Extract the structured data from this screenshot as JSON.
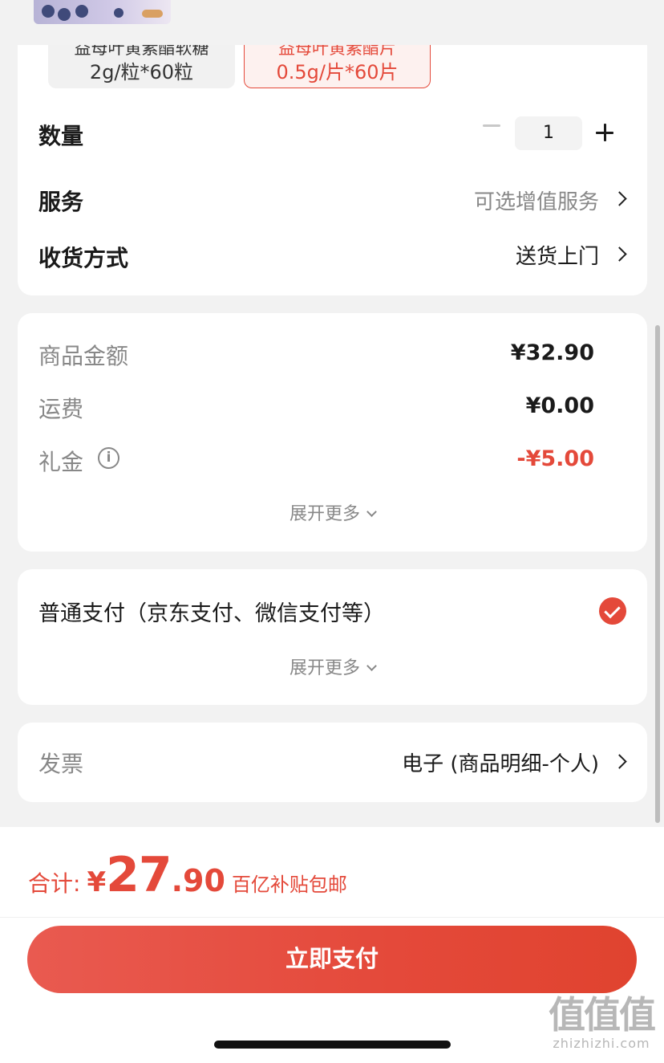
{
  "product_specs": [
    {
      "name": "益母叶黄素酯软糖",
      "size": "2g/粒*60粒",
      "selected": false
    },
    {
      "name": "益母叶黄素酯片",
      "size": "0.5g/片*60片",
      "selected": true
    }
  ],
  "quantity": {
    "label": "数量",
    "value": "1"
  },
  "service": {
    "label": "服务",
    "value": "可选增值服务"
  },
  "delivery": {
    "label": "收货方式",
    "value": "送货上门"
  },
  "fees": {
    "goods_amount": {
      "label": "商品金额",
      "value": "¥32.90"
    },
    "shipping": {
      "label": "运费",
      "value": "¥0.00"
    },
    "gift_money": {
      "label": "礼金",
      "value": "-¥5.00"
    },
    "expand": "展开更多"
  },
  "payment": {
    "method": "普通支付（京东支付、微信支付等）",
    "expand": "展开更多"
  },
  "invoice": {
    "label": "发票",
    "value": "电子 (商品明细-个人)"
  },
  "footer": {
    "total_label": "合计:",
    "currency": "¥",
    "total_int": "27",
    "total_dec": ".90",
    "note": "百亿补贴包邮",
    "pay_button": "立即支付"
  },
  "watermark": {
    "logo": "值值值",
    "url": "zhizhizhi.com"
  },
  "colors": {
    "accent": "#e4493a",
    "muted": "#888888",
    "background": "#f2f2f2"
  }
}
